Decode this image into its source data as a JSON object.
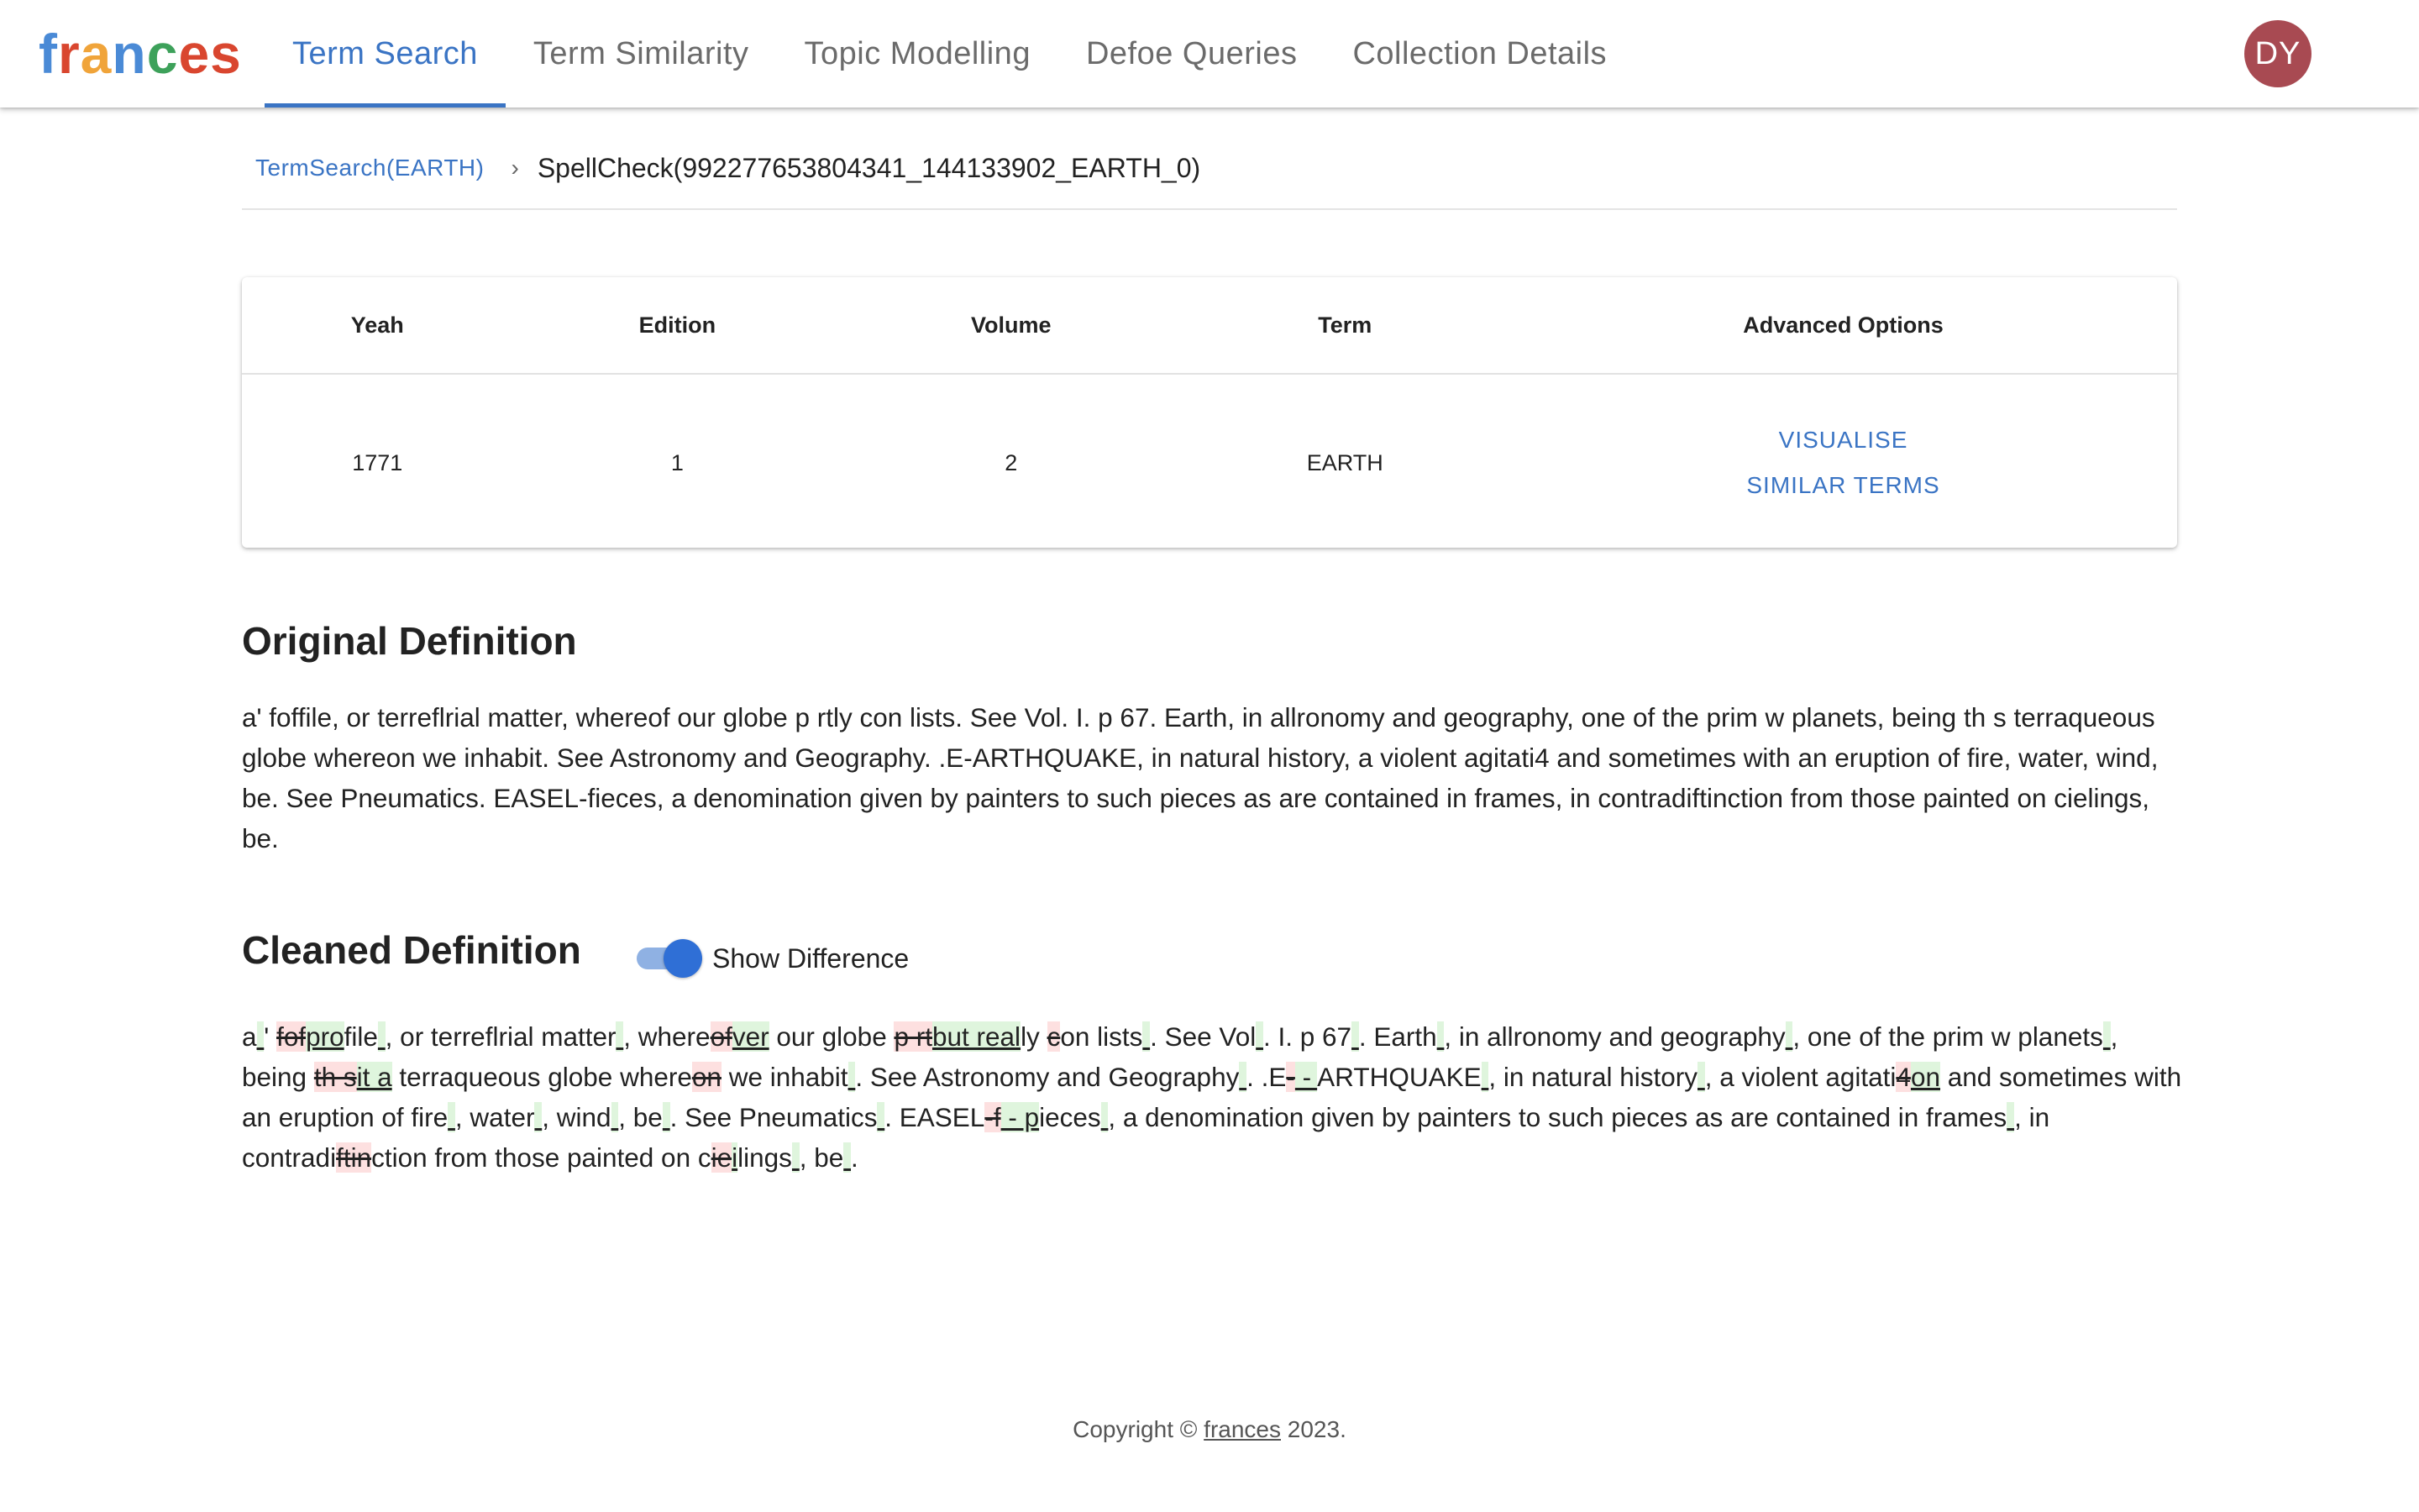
{
  "app": {
    "logo_letters": [
      {
        "char": "f",
        "color": "#4a8ad6"
      },
      {
        "char": "r",
        "color": "#d9462f"
      },
      {
        "char": "a",
        "color": "#f0a43a"
      },
      {
        "char": "n",
        "color": "#4a8ad6"
      },
      {
        "char": "c",
        "color": "#3da15a"
      },
      {
        "char": "e",
        "color": "#d9462f"
      },
      {
        "char": "s",
        "color": "#d9462f"
      }
    ],
    "avatar_initials": "DY",
    "accent_color": "#3a74c4"
  },
  "nav": {
    "tabs": [
      {
        "label": "Term Search",
        "active": true
      },
      {
        "label": "Term Similarity",
        "active": false
      },
      {
        "label": "Topic Modelling",
        "active": false
      },
      {
        "label": "Defoe Queries",
        "active": false
      },
      {
        "label": "Collection Details",
        "active": false
      }
    ]
  },
  "breadcrumb": {
    "link": "TermSearch(EARTH)",
    "separator": "›",
    "current": "SpellCheck(992277653804341_144133902_EARTH_0)"
  },
  "table": {
    "headers": [
      "Yeah",
      "Edition",
      "Volume",
      "Term",
      "Advanced Options"
    ],
    "row": {
      "year": "1771",
      "edition": "1",
      "volume": "2",
      "term": "EARTH"
    },
    "actions": {
      "visualise": "VISUALISE",
      "similar_terms": "SIMILAR TERMS"
    }
  },
  "original": {
    "title": "Original Definition",
    "text": "a' foffile, or terreflrial matter, whereof our globe p rtly con lists. See Vol. I. p 67. Earth, in allronomy and geography, one of the prim w planets, being th s terraqueous globe whereon we inhabit. See Astronomy and Geography. .E-ARTHQUAKE, in natural history, a violent agitati4 and sometimes with an eruption of fire, water, wind, be. See Pneumatics. EASEL-fieces, a denomination given by painters to such pieces as are contained in frames, in contradiftinction from those painted on cielings, be."
  },
  "cleaned": {
    "title": "Cleaned Definition",
    "toggle_label": "Show Difference",
    "show_difference": true,
    "segments": [
      {
        "t": "a"
      },
      {
        "t": " ",
        "op": "ins"
      },
      {
        "t": "' "
      },
      {
        "t": "fof",
        "op": "del"
      },
      {
        "t": "pro",
        "op": "ins"
      },
      {
        "t": "file"
      },
      {
        "t": " ",
        "op": "ins"
      },
      {
        "t": ", or terreflrial matter"
      },
      {
        "t": " ",
        "op": "ins"
      },
      {
        "t": ", where"
      },
      {
        "t": "of",
        "op": "del"
      },
      {
        "t": "ver",
        "op": "ins"
      },
      {
        "t": " our globe "
      },
      {
        "t": "p rt",
        "op": "del"
      },
      {
        "t": "but real",
        "op": "ins"
      },
      {
        "t": "ly "
      },
      {
        "t": "c",
        "op": "del"
      },
      {
        "t": "on lists"
      },
      {
        "t": " ",
        "op": "ins"
      },
      {
        "t": ". See Vol"
      },
      {
        "t": " ",
        "op": "ins"
      },
      {
        "t": ". I. p 67"
      },
      {
        "t": " ",
        "op": "ins"
      },
      {
        "t": ". Earth"
      },
      {
        "t": " ",
        "op": "ins"
      },
      {
        "t": ", in allronomy and geography"
      },
      {
        "t": " ",
        "op": "ins"
      },
      {
        "t": ", one of the prim w planets"
      },
      {
        "t": " ",
        "op": "ins"
      },
      {
        "t": ", being "
      },
      {
        "t": "th s",
        "op": "del"
      },
      {
        "t": "it a",
        "op": "ins"
      },
      {
        "t": " terraqueous globe where"
      },
      {
        "t": "on",
        "op": "del"
      },
      {
        "t": " we inhabit"
      },
      {
        "t": " ",
        "op": "ins"
      },
      {
        "t": ". See Astronomy and Geography"
      },
      {
        "t": " ",
        "op": "ins"
      },
      {
        "t": ". .E"
      },
      {
        "t": "-",
        "op": "del"
      },
      {
        "t": " - ",
        "op": "ins"
      },
      {
        "t": "ARTHQUAKE"
      },
      {
        "t": " ",
        "op": "ins"
      },
      {
        "t": ", in natural history"
      },
      {
        "t": " ",
        "op": "ins"
      },
      {
        "t": ", a violent agitati"
      },
      {
        "t": "4",
        "op": "del"
      },
      {
        "t": "on",
        "op": "ins"
      },
      {
        "t": " and sometimes with an eruption of fire"
      },
      {
        "t": " ",
        "op": "ins"
      },
      {
        "t": ", water"
      },
      {
        "t": " ",
        "op": "ins"
      },
      {
        "t": ", wind"
      },
      {
        "t": " ",
        "op": "ins"
      },
      {
        "t": ", be"
      },
      {
        "t": " ",
        "op": "ins"
      },
      {
        "t": ". See Pneumatics"
      },
      {
        "t": " ",
        "op": "ins"
      },
      {
        "t": ". EASEL"
      },
      {
        "t": "-f",
        "op": "del"
      },
      {
        "t": " - p",
        "op": "ins"
      },
      {
        "t": "ieces"
      },
      {
        "t": " ",
        "op": "ins"
      },
      {
        "t": ", a denomination given by painters to such pieces as are contained in frames"
      },
      {
        "t": " ",
        "op": "ins"
      },
      {
        "t": ", in contradi"
      },
      {
        "t": "ftin",
        "op": "del"
      },
      {
        "t": "ction from those painted on c"
      },
      {
        "t": "ie",
        "op": "del"
      },
      {
        "t": "i",
        "op": "ins"
      },
      {
        "t": "lings"
      },
      {
        "t": " ",
        "op": "ins"
      },
      {
        "t": ", be"
      },
      {
        "t": " ",
        "op": "ins"
      },
      {
        "t": "."
      }
    ]
  },
  "footer": {
    "prefix": "Copyright © ",
    "link": "frances",
    "suffix": " 2023."
  }
}
